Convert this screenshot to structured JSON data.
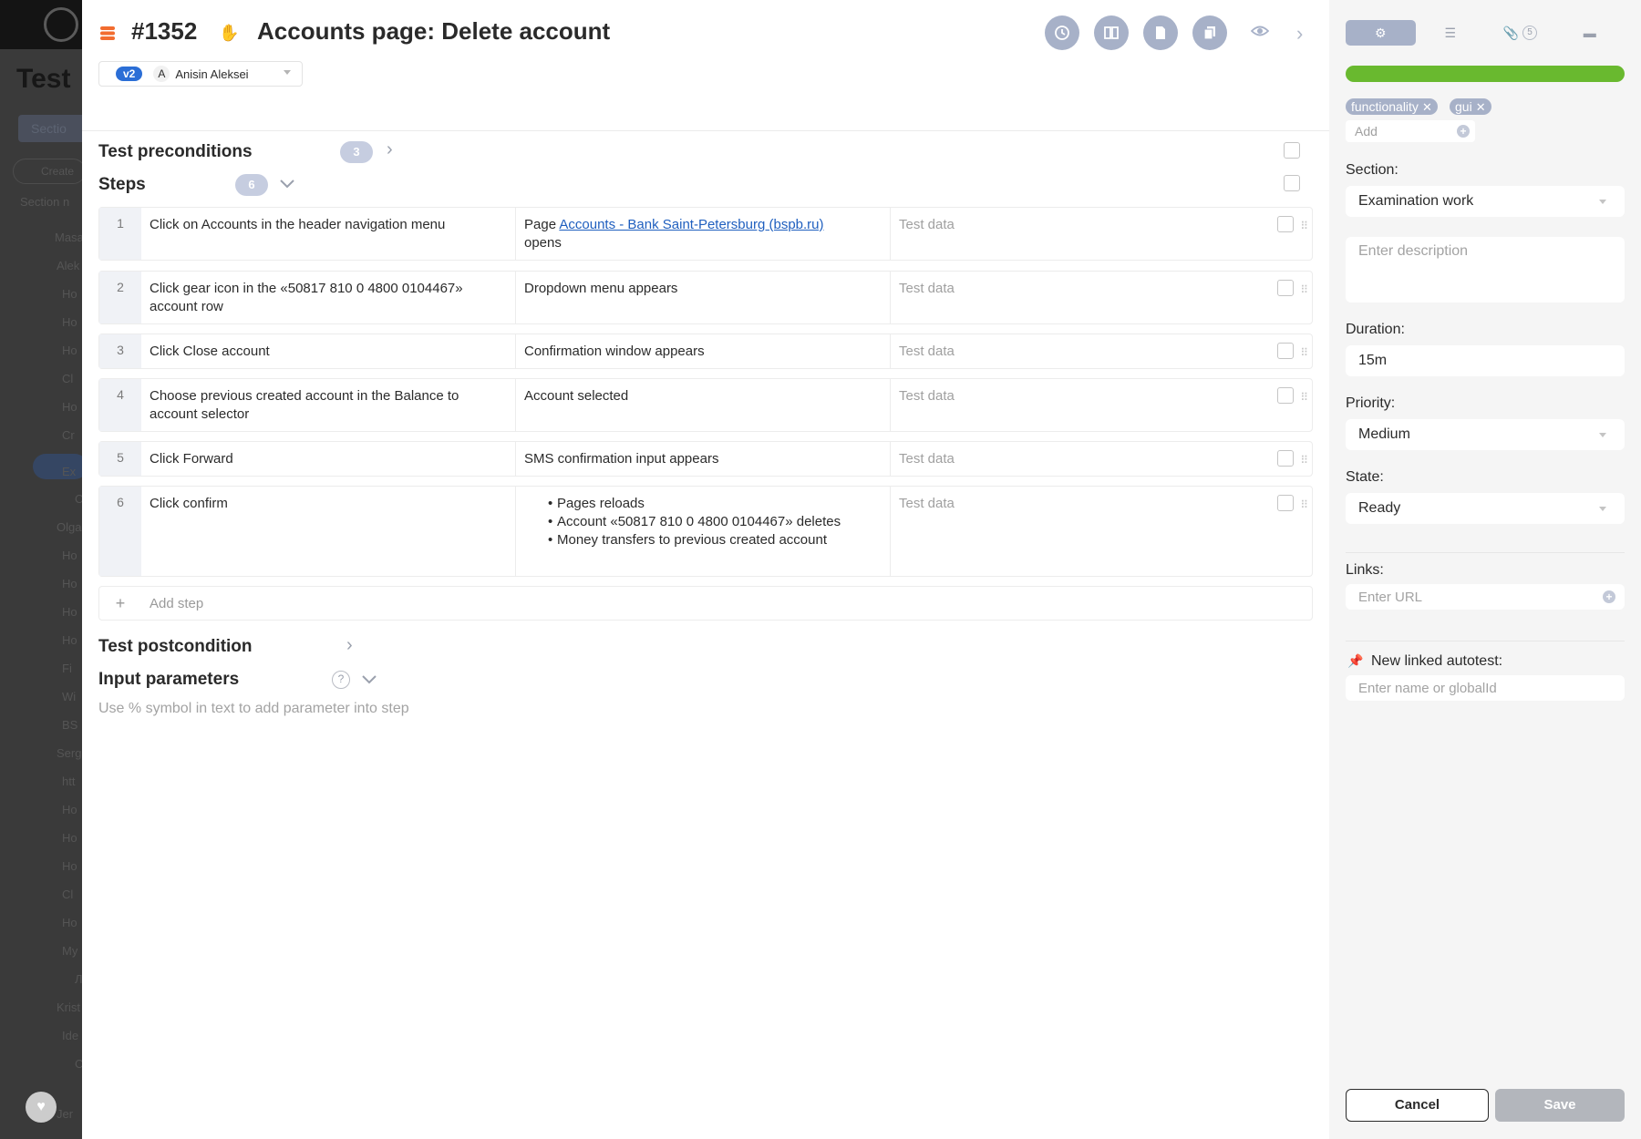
{
  "background": {
    "title": "Test",
    "button": "Sectio",
    "search": "Create",
    "section_header": "Section n",
    "rows": [
      "Masa",
      "Alek",
      "Ho",
      "Ho",
      "Ho",
      "Cl",
      "Ho",
      "Cr",
      "Ex",
      "C",
      "Olga",
      "Ho",
      "Ho",
      "Ho",
      "Ho",
      "Fi",
      "Wi",
      "BS",
      "Serg",
      "htt",
      "Ho",
      "Ho",
      "Ho",
      "Cl",
      "Ho",
      "My",
      "Л",
      "Krist",
      "Ide",
      "C",
      "Jer"
    ]
  },
  "header": {
    "case_id": "#1352",
    "title": "Accounts page: Delete account",
    "version_badge": "v2",
    "author_initial": "A",
    "author_name": "Anisin Aleksei",
    "buttons": [
      "history-icon",
      "book-icon",
      "document-icon",
      "copy-icon",
      "eye-icon",
      "chevron-right-icon"
    ]
  },
  "preconditions": {
    "label": "Test preconditions",
    "count": "3"
  },
  "steps": {
    "label": "Steps",
    "count": "6",
    "placeholder_data": "Test data",
    "items": [
      {
        "num": "1",
        "action": "Click on Accounts in the header navigation menu",
        "result_prefix": "Page ",
        "result_link": "Accounts - Bank Saint-Petersburg (bspb.ru)",
        "result_suffix": "opens"
      },
      {
        "num": "2",
        "action": "Click gear icon in the «50817 810 0 4800 0104467» account row",
        "result": "Dropdown menu appears"
      },
      {
        "num": "3",
        "action": "Click Close account",
        "result": "Confirmation window appears"
      },
      {
        "num": "4",
        "action": "Choose previous created account in the Balance to account selector",
        "result": "Account selected"
      },
      {
        "num": "5",
        "action": "Click Forward",
        "result": "SMS confirmation input appears"
      },
      {
        "num": "6",
        "action": "Click confirm",
        "result_list": [
          "Pages reloads",
          "Account «50817 810 0 4800 0104467» deletes",
          "Money transfers to previous created account"
        ]
      }
    ],
    "add_step": "Add step",
    "add_plus": "+"
  },
  "postcondition": {
    "label": "Test postcondition"
  },
  "input_parameters": {
    "label": "Input parameters",
    "help": "?",
    "hint": "Use % symbol in text to add parameter into step"
  },
  "sidebar": {
    "tabs": [
      "gear-icon",
      "list-icon",
      "paperclip-icon",
      "comment-icon"
    ],
    "attachments_count": "5",
    "progress": 1.0,
    "progress_color": "#69b92f",
    "tags": [
      "functionality",
      "gui"
    ],
    "tag_add_placeholder": "Add",
    "section_label": "Section:",
    "section_value": "Examination work",
    "description_placeholder": "Enter description",
    "duration_label": "Duration:",
    "duration_value": "15m",
    "priority_label": "Priority:",
    "priority_value": "Medium",
    "state_label": "State:",
    "state_value": "Ready",
    "links_label": "Links:",
    "links_placeholder": "Enter URL",
    "autotest_label": "New linked autotest:",
    "autotest_placeholder": "Enter name or globalId",
    "cancel": "Cancel",
    "save": "Save"
  },
  "colors": {
    "accent": "#a7b1c8",
    "link": "#1f5fbf",
    "brand_orange": "#f26c2f",
    "version_blue": "#2b6ed6"
  }
}
